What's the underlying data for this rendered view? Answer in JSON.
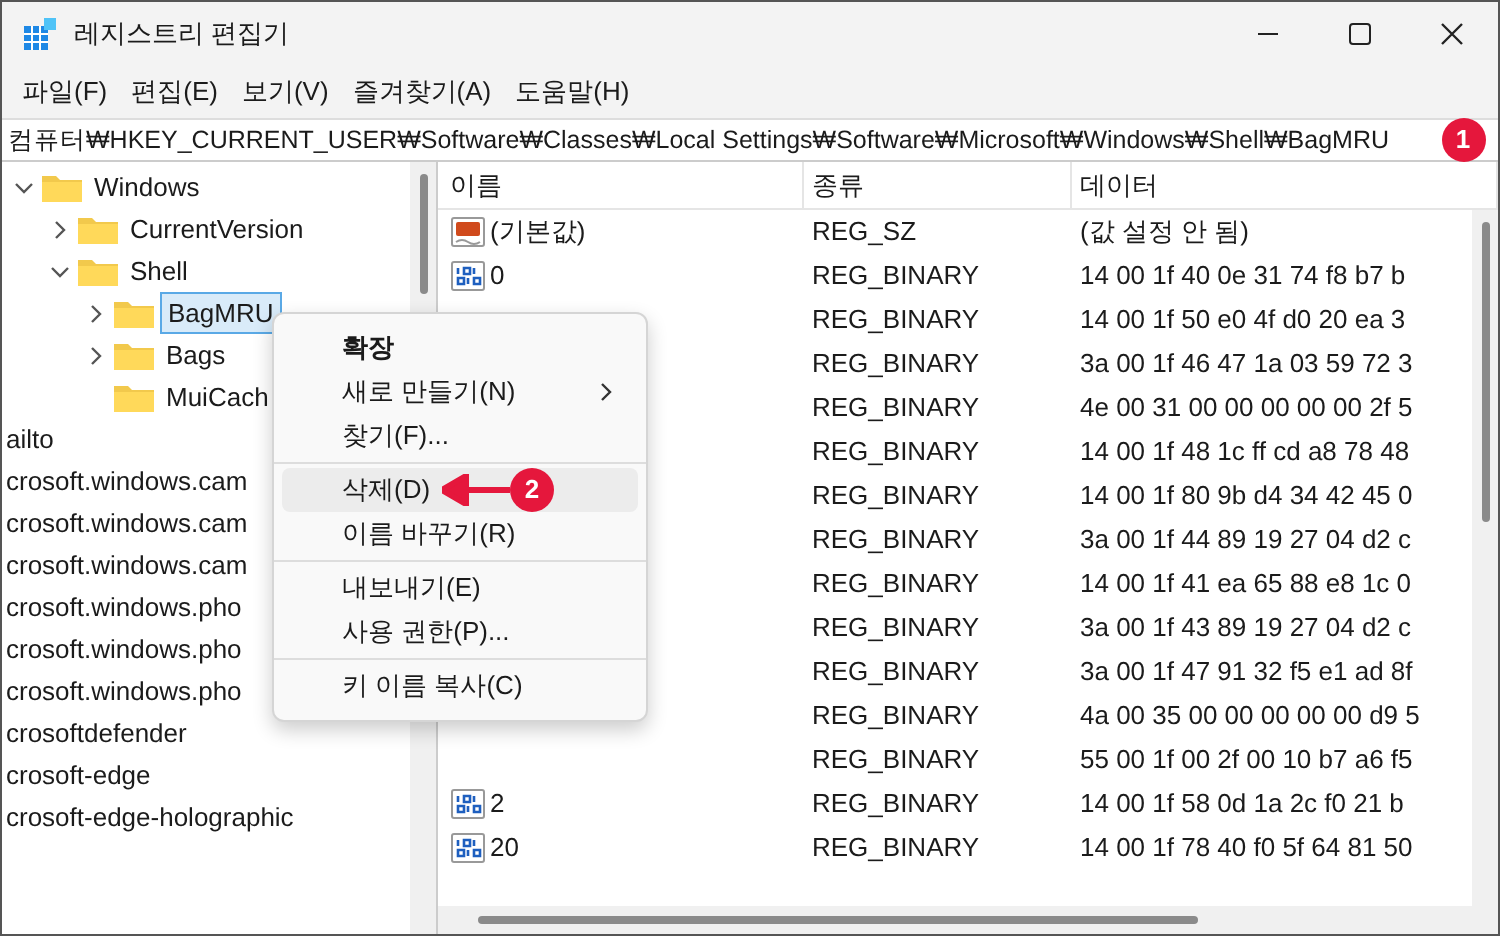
{
  "window": {
    "title": "레지스트리 편집기"
  },
  "menu_bar": [
    "파일(F)",
    "편집(E)",
    "보기(V)",
    "즐겨찾기(A)",
    "도움말(H)"
  ],
  "address": "컴퓨터₩HKEY_CURRENT_USER₩Software₩Classes₩Local Settings₩Software₩Microsoft₩Windows₩Shell₩BagMRU",
  "tree": [
    {
      "label": "Windows",
      "expanded": true,
      "selected": false,
      "children": [
        {
          "label": "CurrentVersion",
          "expanded": false,
          "selected": false
        },
        {
          "label": "Shell",
          "expanded": true,
          "selected": false,
          "children": [
            {
              "label": "BagMRU",
              "expanded": false,
              "selected": true
            },
            {
              "label": "Bags",
              "expanded": false,
              "selected": false
            },
            {
              "label": "MuiCach",
              "selected": false
            }
          ]
        }
      ]
    }
  ],
  "scrolled_keys": [
    "ailto",
    "crosoft.windows.cam",
    "crosoft.windows.cam",
    "crosoft.windows.cam",
    "crosoft.windows.pho",
    "crosoft.windows.pho",
    "crosoft.windows.pho",
    "crosoftdefender",
    "crosoft-edge",
    "crosoft-edge-holographic"
  ],
  "table": {
    "columns": [
      "이름",
      "종류",
      "데이터"
    ],
    "rows": [
      {
        "kind": "string",
        "name": "(기본값)",
        "type": "REG_SZ",
        "data": "(값 설정 안 됨)"
      },
      {
        "kind": "binary",
        "name": "0",
        "type": "REG_BINARY",
        "data": "14 00 1f 40 0e 31 74 f8 b7 b"
      },
      {
        "type": "REG_BINARY",
        "data": "14 00 1f 50 e0 4f d0 20 ea 3"
      },
      {
        "type": "REG_BINARY",
        "data": "3a 00 1f 46 47 1a 03 59 72 3"
      },
      {
        "type": "REG_BINARY",
        "data": "4e 00 31 00 00 00 00 00 2f 5"
      },
      {
        "type": "REG_BINARY",
        "data": "14 00 1f 48 1c ff cd a8 78 48"
      },
      {
        "type": "REG_BINARY",
        "data": "14 00 1f 80 9b d4 34 42 45 0"
      },
      {
        "type": "REG_BINARY",
        "data": "3a 00 1f 44 89 19 27 04 d2 c"
      },
      {
        "type": "REG_BINARY",
        "data": "14 00 1f 41 ea 65 88 e8 1c 0"
      },
      {
        "type": "REG_BINARY",
        "data": "3a 00 1f 43 89 19 27 04 d2 c"
      },
      {
        "type": "REG_BINARY",
        "data": "3a 00 1f 47 91 32 f5 e1 ad 8f"
      },
      {
        "type": "REG_BINARY",
        "data": "4a 00 35 00 00 00 00 00 d9 5"
      },
      {
        "type": "REG_BINARY",
        "data": "55 00 1f 00 2f 00 10 b7 a6 f5"
      },
      {
        "kind": "binary",
        "name": "2",
        "type": "REG_BINARY",
        "data": "14 00 1f 58 0d 1a 2c f0 21 b"
      },
      {
        "kind": "binary",
        "name": "20",
        "type": "REG_BINARY",
        "data": "14 00 1f 78 40 f0 5f 64 81 50"
      }
    ]
  },
  "context_menu": {
    "groups": [
      [
        {
          "label": "확장",
          "bold": true,
          "highlighted": false
        },
        {
          "label": "새로 만들기(N)",
          "submenu": true,
          "highlighted": false
        },
        {
          "label": "찾기(F)...",
          "highlighted": false
        }
      ],
      [
        {
          "label": "삭제(D)",
          "highlighted": true,
          "callout": "2"
        },
        {
          "label": "이름 바꾸기(R)",
          "highlighted": false
        }
      ],
      [
        {
          "label": "내보내기(E)",
          "highlighted": false
        },
        {
          "label": "사용 권한(P)...",
          "highlighted": false
        }
      ],
      [
        {
          "label": "키 이름 복사(C)",
          "highlighted": false
        }
      ]
    ]
  },
  "address_callout": "1"
}
